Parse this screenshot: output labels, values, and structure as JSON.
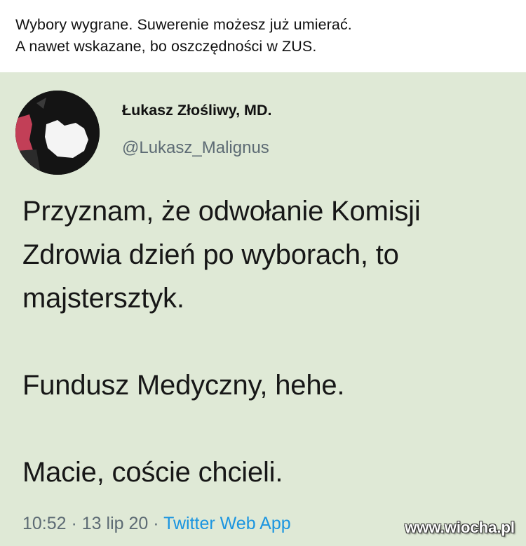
{
  "caption": {
    "line1": "Wybory wygrane. Suwerenie możesz już umierać.",
    "line2": "A nawet wskazane, bo oszczędności w ZUS."
  },
  "tweet": {
    "author_name": "Łukasz Złośliwy, MD.",
    "handle": "@Lukasz_Malignus",
    "paragraphs": [
      "Przyznam, że odwołanie Komisji",
      "Zdrowia dzień po wyborach, to",
      "majstersztyk.",
      "Fundusz Medyczny, hehe.",
      "Macie, coście chcieli."
    ],
    "time": "10:52",
    "separator1": " · ",
    "date": "13 lip 20",
    "separator2": " · ",
    "source": "Twitter Web App"
  },
  "watermark": "www.wiocha.pl",
  "colors": {
    "card_background": "#dfe9d6",
    "link_blue": "#1b95e0",
    "muted_gray": "#5d6b74"
  }
}
